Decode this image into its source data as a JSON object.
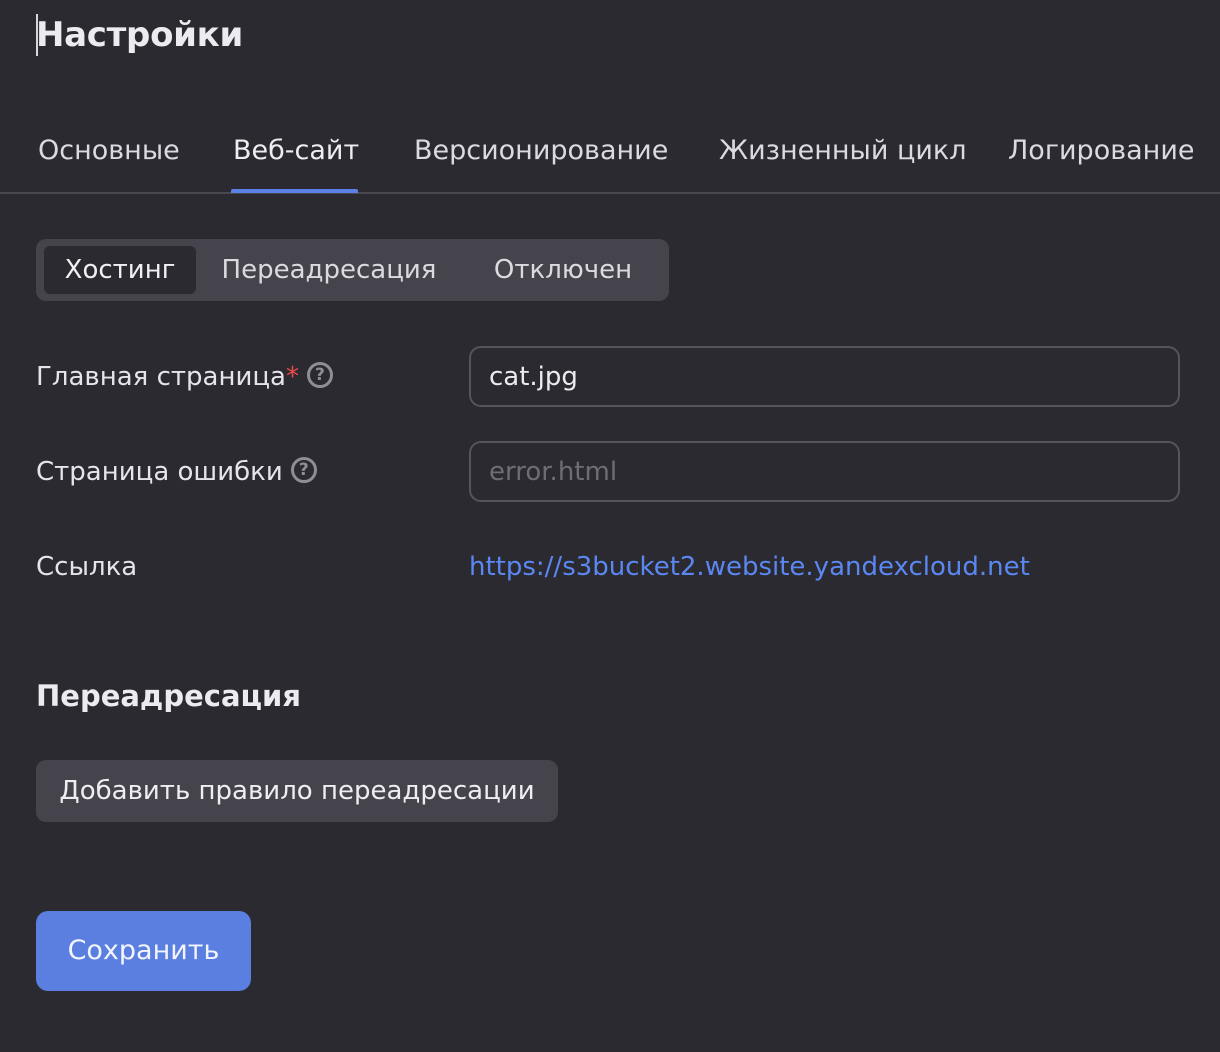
{
  "page": {
    "title": "Настройки"
  },
  "tabs": [
    {
      "label": "Основные",
      "active": false
    },
    {
      "label": "Веб-сайт",
      "active": true
    },
    {
      "label": "Версионирование",
      "active": false
    },
    {
      "label": "Жизненный цикл",
      "active": false
    },
    {
      "label": "Логирование",
      "active": false
    }
  ],
  "mode_switch": {
    "options": [
      "Хостинг",
      "Переадресация",
      "Отключен"
    ],
    "selected": "Хостинг"
  },
  "form": {
    "main_page": {
      "label": "Главная страница",
      "required_mark": "*",
      "value": "cat.jpg",
      "help_icon": "question-circle-icon"
    },
    "error_page": {
      "label": "Страница ошибки",
      "placeholder": "error.html",
      "value": "",
      "help_icon": "question-circle-icon"
    },
    "link": {
      "label": "Ссылка",
      "url": "https://s3bucket2.website.yandexcloud.net"
    }
  },
  "redirect_section": {
    "heading": "Переадресация",
    "add_rule_label": "Добавить правило переадресации"
  },
  "actions": {
    "save_label": "Сохранить"
  },
  "colors": {
    "background": "#2b2a31",
    "accent": "#5a7fe1",
    "link": "#5a87f0",
    "required": "#f04a4a"
  }
}
